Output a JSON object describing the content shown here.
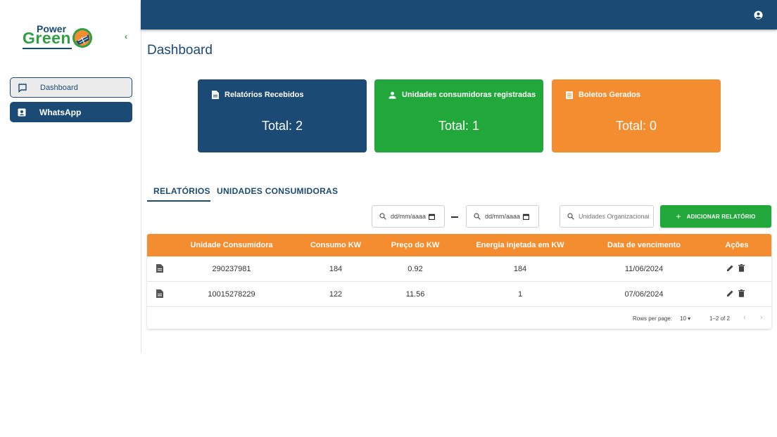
{
  "sidebar": {
    "logo": {
      "line1": "Power",
      "line2": "Green"
    },
    "collapse_glyph": "‹",
    "items": [
      {
        "label": "Dashboard",
        "icon": "chat-bubble-icon",
        "active": false
      },
      {
        "label": "WhatsApp",
        "icon": "contact-card-icon",
        "active": true
      }
    ]
  },
  "topbar": {
    "user_icon": "account-circle-icon"
  },
  "page": {
    "title": "Dashboard"
  },
  "cards": [
    {
      "title": "Relatórios Recebidos",
      "total": "Total: 2",
      "icon": "document-icon",
      "color": "#1b4a74"
    },
    {
      "title": "Unidades consumidoras registradas",
      "total": "Total: 1",
      "icon": "person-icon",
      "color": "#22a83a"
    },
    {
      "title": "Boletos Gerados",
      "total": "Total: 0",
      "icon": "list-icon",
      "color": "#f48c30"
    }
  ],
  "tabs": [
    {
      "label": "RELATÓRIOS",
      "active": true
    },
    {
      "label": "UNIDADES CONSUMIDORAS",
      "active": false
    }
  ],
  "filters": {
    "date_start_placeholder": "dd/mm/aaaa",
    "date_end_placeholder": "dd/mm/aaaa",
    "search_placeholder": "Unidades Organizacionais",
    "add_button": "ADICIONAR RELATÓRIO"
  },
  "table": {
    "columns": [
      "Unidade Consumidora",
      "Consumo KW",
      "Preço do KW",
      "Energia injetada em KW",
      "Data de vencimento",
      "Ações"
    ],
    "rows": [
      {
        "unidade": "290237981",
        "consumo": "184",
        "preco": "0.92",
        "energia": "184",
        "vencimento": "11/06/2024"
      },
      {
        "unidade": "10015278229",
        "consumo": "122",
        "preco": "11.56",
        "energia": "1",
        "vencimento": "07/06/2024"
      }
    ],
    "pagination": {
      "rows_per_page_label": "Rows per page:",
      "rows_per_page": "10",
      "range": "1–2 of 2"
    }
  },
  "colors": {
    "primary": "#1b4a74",
    "green": "#22a83a",
    "orange": "#f48c30"
  }
}
